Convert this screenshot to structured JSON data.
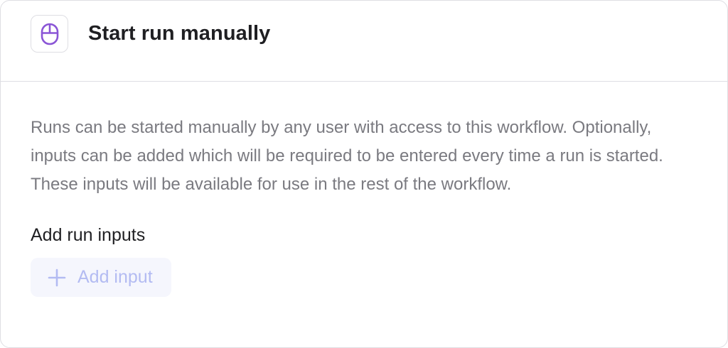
{
  "header": {
    "icon": "mouse-icon",
    "icon_color": "#8a55d6",
    "title": "Start run manually"
  },
  "body": {
    "description": "Runs can be started manually by any user with access to this workflow. Optionally, inputs can be added which will be required to be entered every time a run is started. These inputs will be available for use in the rest of the workflow.",
    "section_label": "Add run inputs",
    "add_button": {
      "icon": "plus-icon",
      "label": "Add input",
      "state": "disabled",
      "color": "#b3bbf2",
      "background": "#f5f6fd"
    }
  }
}
